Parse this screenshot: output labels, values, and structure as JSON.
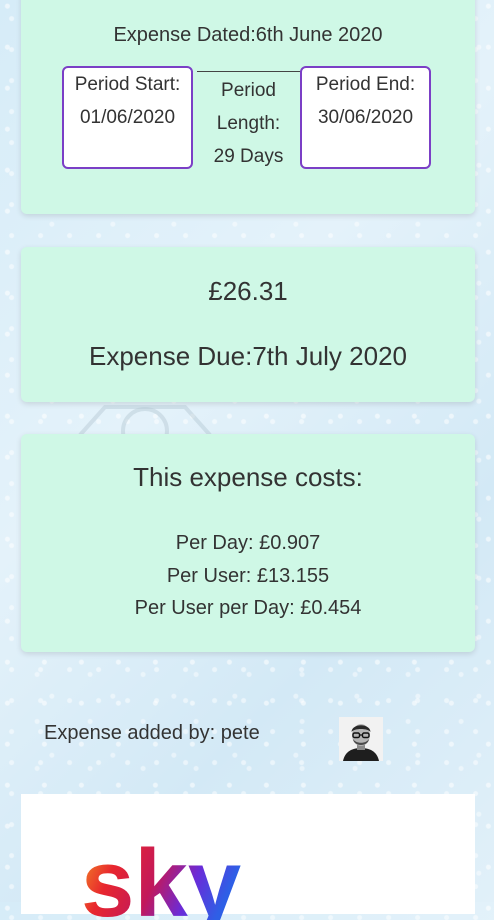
{
  "expense": {
    "dated_label": "Expense Dated:",
    "dated_value": "6th June 2020",
    "period_start_label": "Period Start:",
    "period_start_value": "01/06/2020",
    "period_end_label": "Period End:",
    "period_end_value": "30/06/2020",
    "period_length_line1": "Period",
    "period_length_line2": "Length:",
    "period_length_line3": "29 Days",
    "amount": "£26.31",
    "due_label": "Expense Due:",
    "due_value": "7th July 2020"
  },
  "costs": {
    "title": "This expense costs:",
    "per_day": "Per Day: £0.907",
    "per_user": "Per User: £13.155",
    "per_user_per_day": "Per User per Day: £0.454"
  },
  "added_by": {
    "text": "Expense added by: pete",
    "avatar_icon": "user-avatar-photo"
  },
  "logo": {
    "text": "sky",
    "icon": "sky-logo",
    "gradient_colors": [
      "#f5a623",
      "#e8262e",
      "#c2185b",
      "#6a2bd8",
      "#2e5fe6"
    ]
  },
  "colors": {
    "card_background": "#cff8e6",
    "period_border": "#7b3fc6",
    "page_background": "#dbeef8"
  }
}
